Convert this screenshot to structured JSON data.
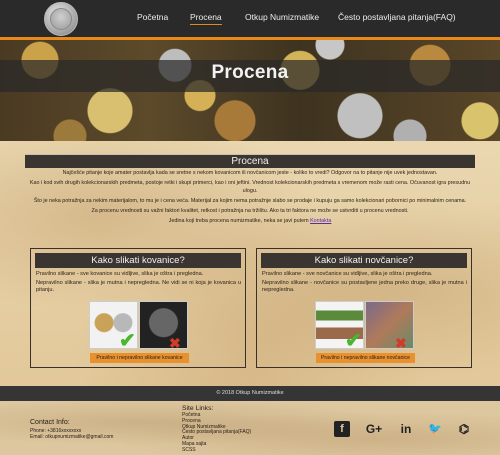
{
  "nav": {
    "items": [
      {
        "label": "Početna"
      },
      {
        "label": "Procena"
      },
      {
        "label": "Otkup Numizmatike"
      },
      {
        "label": "Često postavljana pitanja(FAQ)"
      }
    ]
  },
  "hero": {
    "title": "Procena"
  },
  "section": {
    "title": "Procena",
    "paragraphs": [
      "Najčešće pitanje koje amater postavlja kada se sretne s nekom kovanicom ili novčanicom jeste - koliko to vredi? Odgovor na to pitanje nije uvek jednostavan.",
      "Kao i kod svih drugih kolekcionarskih predmeta, postoje retki i skupi primerci, kao i oni jeftini. Vrednost kolekcionarskih predmeta s vremenom može rasti cena. Očuvanost igra presudnu ulogu.",
      "Što je neka potražnja za nekim materijalom, to mu je i cena veća. Materijal za kojim nema potražnje slabo se prodaje i kupuju ga samo kolekcionari pobornici po minimalnim cenama.",
      "Za procenu vrednosti su važni faktori kvalitet, retkost i potražnja na tržištu. Ako ta tri faktora ne može se ustvrditi u procenu vrednosti."
    ],
    "contact_prefix": "Jedina koji treba procena numizmatike, neka se javi putem ",
    "contact_link": "Kontakta"
  },
  "card_left": {
    "title": "Kako slikati kovanice?",
    "p1": "Pravilno slikane - sve kovanice su vidljive, slika je oštra i pregledna.",
    "p2": "Nepravilno slikane - slika je mutna i nepregledna. Ne vidi se ni koja je kovanica u pitanju.",
    "caption": "Pravilno i nepravilno slikane kovanice",
    "check": "✔",
    "cross": "✖"
  },
  "card_right": {
    "title": "Kako slikati novčanice?",
    "p1": "Pravilno slikane - sve novčanice su vidljive, slika je oštra i pregledna.",
    "p2": "Nepravilno slikane - novčanice su postavljene jedna preko druge, slika je mutna i nepregledna.",
    "caption": "Pravilno i nepravilno slikane novčanice",
    "check": "✔",
    "cross": "✖"
  },
  "footer": {
    "copyright": "© 2018 Otkup Numizmatike",
    "contact_heading": "Contact Info:",
    "phone": "Phone: +3816xxxxxxxx",
    "email": "Email: otkupnumizmatike@gmail.com",
    "links_heading": "Site Links:",
    "links": [
      "Početna",
      "Procena",
      "Otkup Numizmatike",
      "Često postavljana pitanja(FAQ)",
      "Autor",
      "Mapa sajta",
      "SCSS"
    ],
    "social": [
      "f",
      "G+",
      "in",
      "🐦",
      "⌬"
    ]
  }
}
